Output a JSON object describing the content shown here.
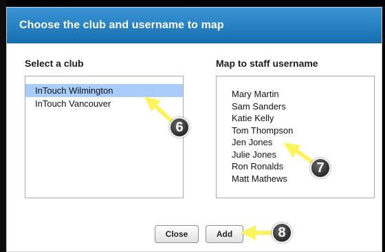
{
  "dialog": {
    "title": "Choose the club and username to map"
  },
  "clubs": {
    "label": "Select a club",
    "items": [
      {
        "label": "InTouch Wilmington",
        "selected": true
      },
      {
        "label": "InTouch Vancouver",
        "selected": false
      }
    ]
  },
  "staff": {
    "label": "Map to staff username",
    "items": [
      {
        "label": "Mary Martin"
      },
      {
        "label": "Sam Sanders"
      },
      {
        "label": "Katie Kelly"
      },
      {
        "label": "Tom Thompson"
      },
      {
        "label": "Jen Jones"
      },
      {
        "label": "Julie Jones"
      },
      {
        "label": "Ron Ronalds"
      },
      {
        "label": "Matt Mathews"
      }
    ]
  },
  "buttons": {
    "close_label": "Close",
    "add_label": "Add"
  },
  "callouts": {
    "select_club": "6",
    "select_staff": "7",
    "add": "8"
  },
  "colors": {
    "header": "#1e78b9",
    "selection": "#a9cdfb",
    "callout_arrow": "#fdf35a"
  }
}
